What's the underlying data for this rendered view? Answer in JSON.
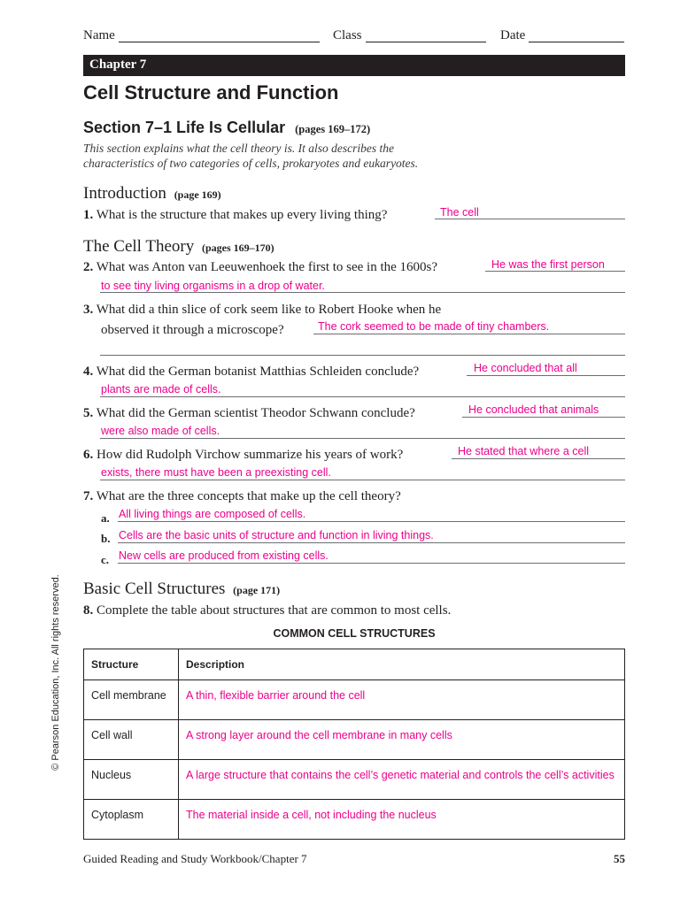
{
  "header": {
    "name_label": "Name",
    "class_label": "Class",
    "date_label": "Date",
    "chapter_bar": "Chapter 7"
  },
  "title": "Cell Structure and Function",
  "section": {
    "title": "Section 7–1  Life Is Cellular",
    "pages": "(pages 169–172)",
    "intro_line1": "This section explains what the cell theory is. It also describes the",
    "intro_line2": "characteristics of two categories of cells, prokaryotes and eukaryotes."
  },
  "introduction": {
    "heading": "Introduction",
    "pages": "(page 169)",
    "q1": {
      "num": "1.",
      "text": "What is the structure that makes up every living thing?",
      "answer": "The cell"
    }
  },
  "cell_theory": {
    "heading": "The Cell Theory",
    "pages": "(pages 169–170)",
    "q2": {
      "num": "2.",
      "text": "What was Anton van Leeuwenhoek the first to see in the 1600s?",
      "answer1": "He was the first person",
      "answer2": "to see tiny living organisms in a drop of water."
    },
    "q3": {
      "num": "3.",
      "text1": "What did a thin slice of cork seem like to Robert Hooke when he",
      "text2": "observed it through a microscope?",
      "answer": "The cork seemed to be made of tiny chambers."
    },
    "q4": {
      "num": "4.",
      "text": "What did the German botanist Matthias Schleiden conclude?",
      "answer1": "He concluded that all",
      "answer2": "plants are made of cells."
    },
    "q5": {
      "num": "5.",
      "text": "What did the German scientist Theodor Schwann conclude?",
      "answer1": "He concluded that animals",
      "answer2": "were also made of cells."
    },
    "q6": {
      "num": "6.",
      "text": "How did Rudolph Virchow summarize his years of work?",
      "answer1": "He stated that where a cell",
      "answer2": "exists, there must have been a preexisting cell."
    },
    "q7": {
      "num": "7.",
      "text": "What are the three concepts that make up the cell theory?",
      "items": [
        {
          "letter": "a.",
          "answer": "All living things are composed of cells."
        },
        {
          "letter": "b.",
          "answer": "Cells are the basic units of structure and function in living things."
        },
        {
          "letter": "c.",
          "answer": "New cells are produced from existing cells."
        }
      ]
    }
  },
  "basic_structures": {
    "heading": "Basic Cell Structures",
    "pages": "(page 171)",
    "q8": {
      "num": "8.",
      "text": "Complete the table about structures that are common to most cells."
    },
    "table_title": "COMMON CELL STRUCTURES",
    "columns": [
      "Structure",
      "Description"
    ],
    "rows": [
      {
        "structure": "Cell membrane",
        "description": "A thin, flexible barrier around the cell"
      },
      {
        "structure": "Cell wall",
        "description": "A strong layer around the cell membrane in many cells"
      },
      {
        "structure": "Nucleus",
        "description": "A large structure that contains the cell’s genetic material and controls the cell’s activities"
      },
      {
        "structure": "Cytoplasm",
        "description": "The material inside a cell, not including the nucleus"
      }
    ]
  },
  "copyright": "© Pearson Education, Inc. All rights reserved.",
  "footer": {
    "book": "Guided Reading and Study Workbook/Chapter 7",
    "page": "55"
  },
  "colors": {
    "answer": "#ec008c",
    "text": "#231f20",
    "bar": "#231f20"
  }
}
